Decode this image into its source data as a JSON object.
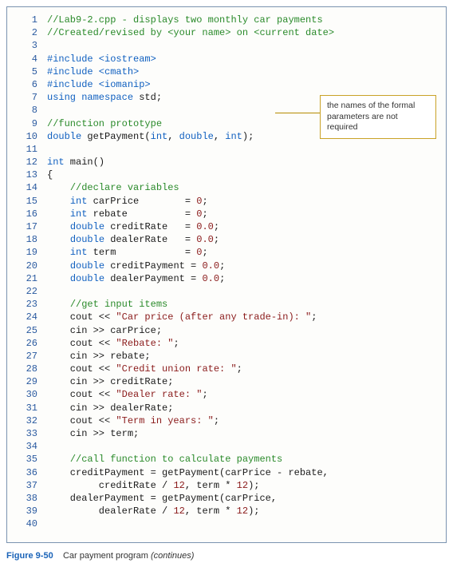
{
  "callout": {
    "text": "the names of the formal parameters are not required"
  },
  "caption": {
    "label": "Figure 9-50",
    "title": "Car payment program",
    "continues": "(continues)"
  },
  "code": [
    {
      "n": 1,
      "segs": [
        [
          "cm",
          "//Lab9-2.cpp - displays two monthly car payments"
        ]
      ]
    },
    {
      "n": 2,
      "segs": [
        [
          "cm",
          "//Created/revised by <your name> on <current date>"
        ]
      ]
    },
    {
      "n": 3,
      "segs": [
        [
          "",
          ""
        ]
      ]
    },
    {
      "n": 4,
      "segs": [
        [
          "kw",
          "#include <iostream>"
        ]
      ]
    },
    {
      "n": 5,
      "segs": [
        [
          "kw",
          "#include <cmath>"
        ]
      ]
    },
    {
      "n": 6,
      "segs": [
        [
          "kw",
          "#include <iomanip>"
        ]
      ]
    },
    {
      "n": 7,
      "segs": [
        [
          "kw",
          "using namespace"
        ],
        [
          "",
          " std;"
        ]
      ]
    },
    {
      "n": 8,
      "segs": [
        [
          "",
          ""
        ]
      ]
    },
    {
      "n": 9,
      "segs": [
        [
          "cm",
          "//function prototype"
        ]
      ]
    },
    {
      "n": 10,
      "segs": [
        [
          "kw",
          "double"
        ],
        [
          "",
          " getPayment("
        ],
        [
          "kw",
          "int"
        ],
        [
          "",
          ", "
        ],
        [
          "kw",
          "double"
        ],
        [
          "",
          ", "
        ],
        [
          "kw",
          "int"
        ],
        [
          "",
          ");"
        ]
      ]
    },
    {
      "n": 11,
      "segs": [
        [
          "",
          ""
        ]
      ]
    },
    {
      "n": 12,
      "segs": [
        [
          "kw",
          "int"
        ],
        [
          "",
          " main()"
        ]
      ]
    },
    {
      "n": 13,
      "segs": [
        [
          "",
          "{"
        ]
      ]
    },
    {
      "n": 14,
      "segs": [
        [
          "",
          "    "
        ],
        [
          "cm",
          "//declare variables"
        ]
      ]
    },
    {
      "n": 15,
      "segs": [
        [
          "",
          "    "
        ],
        [
          "kw",
          "int"
        ],
        [
          "",
          " carPrice        = "
        ],
        [
          "num",
          "0"
        ],
        [
          "",
          ";"
        ]
      ]
    },
    {
      "n": 16,
      "segs": [
        [
          "",
          "    "
        ],
        [
          "kw",
          "int"
        ],
        [
          "",
          " rebate          = "
        ],
        [
          "num",
          "0"
        ],
        [
          "",
          ";"
        ]
      ]
    },
    {
      "n": 17,
      "segs": [
        [
          "",
          "    "
        ],
        [
          "kw",
          "double"
        ],
        [
          "",
          " creditRate   = "
        ],
        [
          "num",
          "0.0"
        ],
        [
          "",
          ";"
        ]
      ]
    },
    {
      "n": 18,
      "segs": [
        [
          "",
          "    "
        ],
        [
          "kw",
          "double"
        ],
        [
          "",
          " dealerRate   = "
        ],
        [
          "num",
          "0.0"
        ],
        [
          "",
          ";"
        ]
      ]
    },
    {
      "n": 19,
      "segs": [
        [
          "",
          "    "
        ],
        [
          "kw",
          "int"
        ],
        [
          "",
          " term            = "
        ],
        [
          "num",
          "0"
        ],
        [
          "",
          ";"
        ]
      ]
    },
    {
      "n": 20,
      "segs": [
        [
          "",
          "    "
        ],
        [
          "kw",
          "double"
        ],
        [
          "",
          " creditPayment = "
        ],
        [
          "num",
          "0.0"
        ],
        [
          "",
          ";"
        ]
      ]
    },
    {
      "n": 21,
      "segs": [
        [
          "",
          "    "
        ],
        [
          "kw",
          "double"
        ],
        [
          "",
          " dealerPayment = "
        ],
        [
          "num",
          "0.0"
        ],
        [
          "",
          ";"
        ]
      ]
    },
    {
      "n": 22,
      "segs": [
        [
          "",
          ""
        ]
      ]
    },
    {
      "n": 23,
      "segs": [
        [
          "",
          "    "
        ],
        [
          "cm",
          "//get input items"
        ]
      ]
    },
    {
      "n": 24,
      "segs": [
        [
          "",
          "    cout << "
        ],
        [
          "str",
          "\"Car price (after any trade-in): \""
        ],
        [
          "",
          ";"
        ]
      ]
    },
    {
      "n": 25,
      "segs": [
        [
          "",
          "    cin >> carPrice;"
        ]
      ]
    },
    {
      "n": 26,
      "segs": [
        [
          "",
          "    cout << "
        ],
        [
          "str",
          "\"Rebate: \""
        ],
        [
          "",
          ";"
        ]
      ]
    },
    {
      "n": 27,
      "segs": [
        [
          "",
          "    cin >> rebate;"
        ]
      ]
    },
    {
      "n": 28,
      "segs": [
        [
          "",
          "    cout << "
        ],
        [
          "str",
          "\"Credit union rate: \""
        ],
        [
          "",
          ";"
        ]
      ]
    },
    {
      "n": 29,
      "segs": [
        [
          "",
          "    cin >> creditRate;"
        ]
      ]
    },
    {
      "n": 30,
      "segs": [
        [
          "",
          "    cout << "
        ],
        [
          "str",
          "\"Dealer rate: \""
        ],
        [
          "",
          ";"
        ]
      ]
    },
    {
      "n": 31,
      "segs": [
        [
          "",
          "    cin >> dealerRate;"
        ]
      ]
    },
    {
      "n": 32,
      "segs": [
        [
          "",
          "    cout << "
        ],
        [
          "str",
          "\"Term in years: \""
        ],
        [
          "",
          ";"
        ]
      ]
    },
    {
      "n": 33,
      "segs": [
        [
          "",
          "    cin >> term;"
        ]
      ]
    },
    {
      "n": 34,
      "segs": [
        [
          "",
          ""
        ]
      ]
    },
    {
      "n": 35,
      "segs": [
        [
          "",
          "    "
        ],
        [
          "cm",
          "//call function to calculate payments"
        ]
      ]
    },
    {
      "n": 36,
      "segs": [
        [
          "",
          "    creditPayment = getPayment(carPrice - rebate,"
        ]
      ]
    },
    {
      "n": 37,
      "segs": [
        [
          "",
          "         creditRate / "
        ],
        [
          "num",
          "12"
        ],
        [
          "",
          ", term * "
        ],
        [
          "num",
          "12"
        ],
        [
          "",
          ");"
        ]
      ]
    },
    {
      "n": 38,
      "segs": [
        [
          "",
          "    dealerPayment = getPayment(carPrice,"
        ]
      ]
    },
    {
      "n": 39,
      "segs": [
        [
          "",
          "         dealerRate / "
        ],
        [
          "num",
          "12"
        ],
        [
          "",
          ", term * "
        ],
        [
          "num",
          "12"
        ],
        [
          "",
          ");"
        ]
      ]
    },
    {
      "n": 40,
      "segs": [
        [
          "",
          ""
        ]
      ]
    }
  ]
}
